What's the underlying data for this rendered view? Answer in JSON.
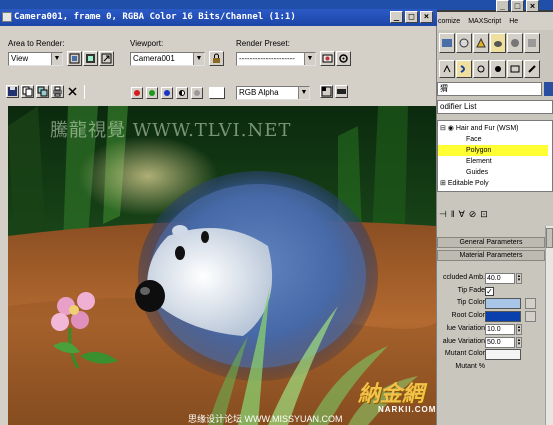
{
  "window": {
    "title": "Camera001, frame 0, RGBA Color 16 Bits/Channel (1:1)",
    "minimize": "_",
    "maximize": "□",
    "close": "×"
  },
  "toolbar": {
    "area_label": "Area to Render:",
    "area_value": "View",
    "viewport_label": "Viewport:",
    "viewport_value": "Camera001",
    "preset_label": "Render Preset:",
    "preset_value": "---------------------",
    "channel_value": "RGB Alpha"
  },
  "render_image": {
    "watermark_top": "騰龍視覺 WWW.TLVI.NET",
    "watermark_bottom": "思缘设计论坛  WWW.MISSYUAN.COM",
    "watermark_logo": "納金網",
    "watermark_logo_sub": "NARKII.COM"
  },
  "max_ui": {
    "menu_items": [
      "comize",
      "MAXScript",
      "He"
    ],
    "object_name": "猬",
    "modifier_list": "odifier List",
    "stack": [
      {
        "label": "Hair and Fur (WSM)",
        "level": 0,
        "selected": false
      },
      {
        "label": "Face",
        "level": 1,
        "selected": false
      },
      {
        "label": "Polygon",
        "level": 1,
        "selected": true
      },
      {
        "label": "Element",
        "level": 1,
        "selected": false
      },
      {
        "label": "Guides",
        "level": 1,
        "selected": false
      },
      {
        "label": "Editable Poly",
        "level": 0,
        "selected": false
      }
    ],
    "rollouts": {
      "general": "General Parameters",
      "material": "Material Parameters"
    },
    "params": {
      "occluded_amb_label": "ccluded Amb.",
      "occluded_amb_value": "40.0",
      "tip_fade_label": "Tip Fade",
      "tip_fade_checked": "✓",
      "tip_color_label": "Tip Color",
      "tip_color": "#a9c6e8",
      "root_color_label": "Root Color",
      "root_color": "#0a3fae",
      "hue_var_label": "lue Variation",
      "hue_var_value": "10.0",
      "value_var_label": "alue Variation",
      "value_var_value": "50.0",
      "mutant_color_label": "Mutant Color",
      "mutant_color": "#f4f4f4",
      "mutant_pct_label": "Mutant %"
    }
  }
}
